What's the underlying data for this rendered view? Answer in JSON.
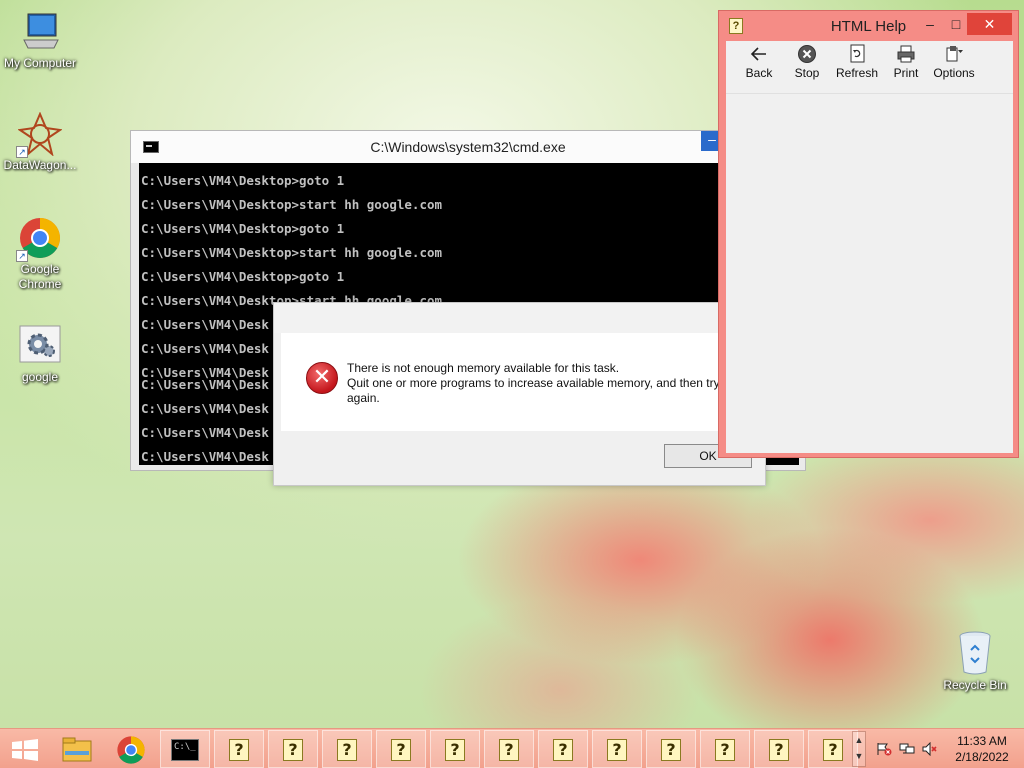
{
  "desktop": {
    "icons": [
      {
        "label": "My Computer",
        "icon": "computer-icon"
      },
      {
        "label": "DataWagon...",
        "icon": "datawagon-icon"
      },
      {
        "label": "Google Chrome",
        "icon": "chrome-icon"
      },
      {
        "label": "google",
        "icon": "settings-shortcut-icon"
      }
    ],
    "recycle_bin": {
      "label": "Recycle Bin",
      "icon": "recycle-bin-icon"
    }
  },
  "cmd": {
    "title": "C:\\Windows\\system32\\cmd.exe",
    "lines": [
      "C:\\Users\\VM4\\Desktop>goto 1",
      "C:\\Users\\VM4\\Desktop>start hh google.com",
      "C:\\Users\\VM4\\Desktop>goto 1",
      "C:\\Users\\VM4\\Desktop>start hh google.com",
      "C:\\Users\\VM4\\Desktop>goto 1",
      "C:\\Users\\VM4\\Desktop>start hh google.com",
      "C:\\Users\\VM4\\Desk",
      "C:\\Users\\VM4\\Desk",
      "C:\\Users\\VM4\\Desk",
      "C:\\Users\\VM4\\Desk",
      "C:\\Users\\VM4\\Desk",
      "C:\\Users\\VM4\\Desk",
      "C:\\Users\\VM4\\Desk"
    ],
    "minimize_label": "–"
  },
  "error_dialog": {
    "line1": "There is not enough memory available for this task.",
    "line2": "Quit one or more programs to increase available memory, and then try",
    "line3": "again.",
    "ok_label": "OK"
  },
  "help": {
    "title": "HTML Help",
    "minimize": "–",
    "maximize": "□",
    "close": "✕",
    "toolbar": {
      "back": "Back",
      "stop": "Stop",
      "refresh": "Refresh",
      "print": "Print",
      "options": "Options"
    }
  },
  "taskbar": {
    "time": "11:33 AM",
    "date": "2/18/2022",
    "help_button_count": 12
  }
}
